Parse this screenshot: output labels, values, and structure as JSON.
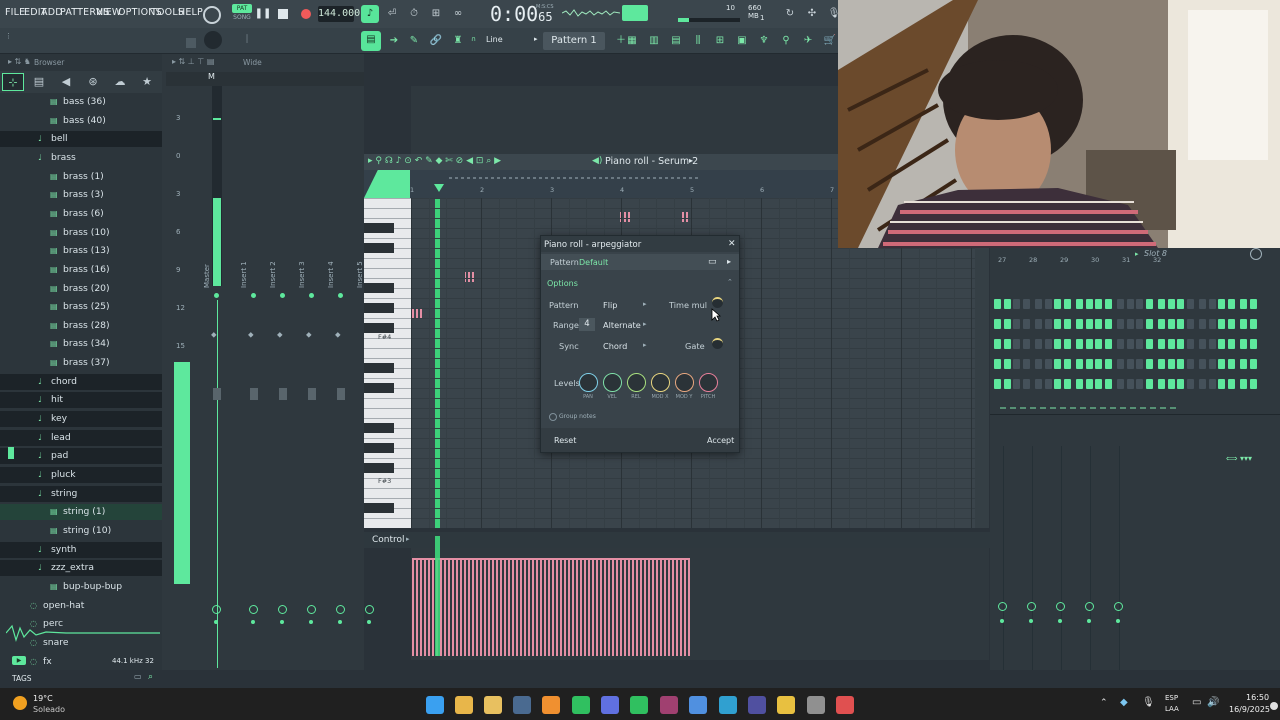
{
  "menu": [
    "FILE",
    "EDIT",
    "ADD",
    "PATTERNS",
    "VIEW",
    "OPTIONS",
    "TOOLS",
    "HELP"
  ],
  "transport": {
    "pat_label": "PAT",
    "song_label": "SONG",
    "tempo": "144.000",
    "time": "0:00",
    "time_sub": "65",
    "time_unit": "M:S:CS",
    "memory": "660 MB",
    "cpu_val": "10",
    "poly_val": "1"
  },
  "toolbar2": {
    "snap_mode": "Line",
    "pattern_name": "Pattern 1"
  },
  "browser": {
    "title": "Browser",
    "items": [
      {
        "label": "bass (36)",
        "type": "file",
        "indent": 2
      },
      {
        "label": "bass (40)",
        "type": "file",
        "indent": 2
      },
      {
        "label": "bell",
        "type": "folder",
        "indent": 1
      },
      {
        "label": "brass",
        "type": "folder",
        "indent": 1
      },
      {
        "label": "brass (1)",
        "type": "file",
        "indent": 2
      },
      {
        "label": "brass (3)",
        "type": "file",
        "indent": 2
      },
      {
        "label": "brass (6)",
        "type": "file",
        "indent": 2
      },
      {
        "label": "brass (10)",
        "type": "file",
        "indent": 2
      },
      {
        "label": "brass (13)",
        "type": "file",
        "indent": 2
      },
      {
        "label": "brass (16)",
        "type": "file",
        "indent": 2
      },
      {
        "label": "brass (20)",
        "type": "file",
        "indent": 2
      },
      {
        "label": "brass (25)",
        "type": "file",
        "indent": 2
      },
      {
        "label": "brass (28)",
        "type": "file",
        "indent": 2
      },
      {
        "label": "brass (34)",
        "type": "file",
        "indent": 2
      },
      {
        "label": "brass (37)",
        "type": "file",
        "indent": 2
      },
      {
        "label": "chord",
        "type": "folder",
        "indent": 1
      },
      {
        "label": "hit",
        "type": "folder",
        "indent": 1
      },
      {
        "label": "key",
        "type": "folder",
        "indent": 1
      },
      {
        "label": "lead",
        "type": "folder",
        "indent": 1
      },
      {
        "label": "pad",
        "type": "folder",
        "indent": 1
      },
      {
        "label": "pluck",
        "type": "folder",
        "indent": 1
      },
      {
        "label": "string",
        "type": "folder",
        "indent": 1
      },
      {
        "label": "string (1)",
        "type": "file",
        "indent": 2
      },
      {
        "label": "string (10)",
        "type": "file",
        "indent": 2
      },
      {
        "label": "synth",
        "type": "folder",
        "indent": 1
      },
      {
        "label": "zzz_extra",
        "type": "folder",
        "indent": 1
      },
      {
        "label": "bup-bup-bup",
        "type": "file",
        "indent": 2
      },
      {
        "label": "open-hat",
        "type": "root",
        "indent": 0
      },
      {
        "label": "perc",
        "type": "root",
        "indent": 0
      },
      {
        "label": "snare",
        "type": "root",
        "indent": 0
      },
      {
        "label": "fx",
        "type": "root",
        "indent": 0
      }
    ],
    "sample_rate": "44.1 kHz 32",
    "tags_label": "TAGS"
  },
  "mixer": {
    "view_label": "Wide",
    "tracks": [
      "Master",
      "Insert 1",
      "Insert 2",
      "Insert 3",
      "Insert 4",
      "Insert 5"
    ],
    "scale": [
      "3",
      "0",
      "3",
      "6",
      "9",
      "12",
      "15"
    ]
  },
  "piano_roll": {
    "title": "Piano roll - Serum 2",
    "ruler": [
      "1",
      "2",
      "3",
      "4",
      "5",
      "6",
      "7"
    ],
    "key_labels": [
      "F#4",
      "F#3"
    ],
    "control_label": "Control"
  },
  "arp_dialog": {
    "title": "Piano roll - arpeggiator",
    "pattern_label": "Pattern",
    "pattern_value": "Default",
    "options_label": "Options",
    "rows": {
      "pattern": {
        "label": "Pattern",
        "value": "Flip"
      },
      "range": {
        "label": "Range",
        "number": "4",
        "value": "Alternate"
      },
      "sync": {
        "label": "Sync",
        "value": "Chord"
      },
      "time_mul": "Time mul",
      "gate": "Gate"
    },
    "levels_label": "Levels",
    "knobs": [
      {
        "cap": "PAN",
        "color": "#7fd0e8"
      },
      {
        "cap": "VEL",
        "color": "#7fe0a8"
      },
      {
        "cap": "REL",
        "color": "#a8e07f"
      },
      {
        "cap": "MOD X",
        "color": "#e8d57f"
      },
      {
        "cap": "MOD Y",
        "color": "#e8a77f"
      },
      {
        "cap": "PITCH",
        "color": "#e87f9a"
      }
    ],
    "group_notes": "Group notes",
    "reset": "Reset",
    "accept": "Accept"
  },
  "channel_rack": {
    "title": "Slot 8",
    "ruler": [
      "27",
      "28",
      "29",
      "30",
      "31",
      "32"
    ]
  },
  "taskbar": {
    "weather_temp": "19°C",
    "weather_desc": "Soleado",
    "lang1": "ESP",
    "lang2": "LAA",
    "clock_time": "16:50",
    "clock_date": "16/9/2025"
  },
  "colors": {
    "accent": "#5ee89d",
    "note": "#e58fa5",
    "playhead": "#3ee07f"
  }
}
